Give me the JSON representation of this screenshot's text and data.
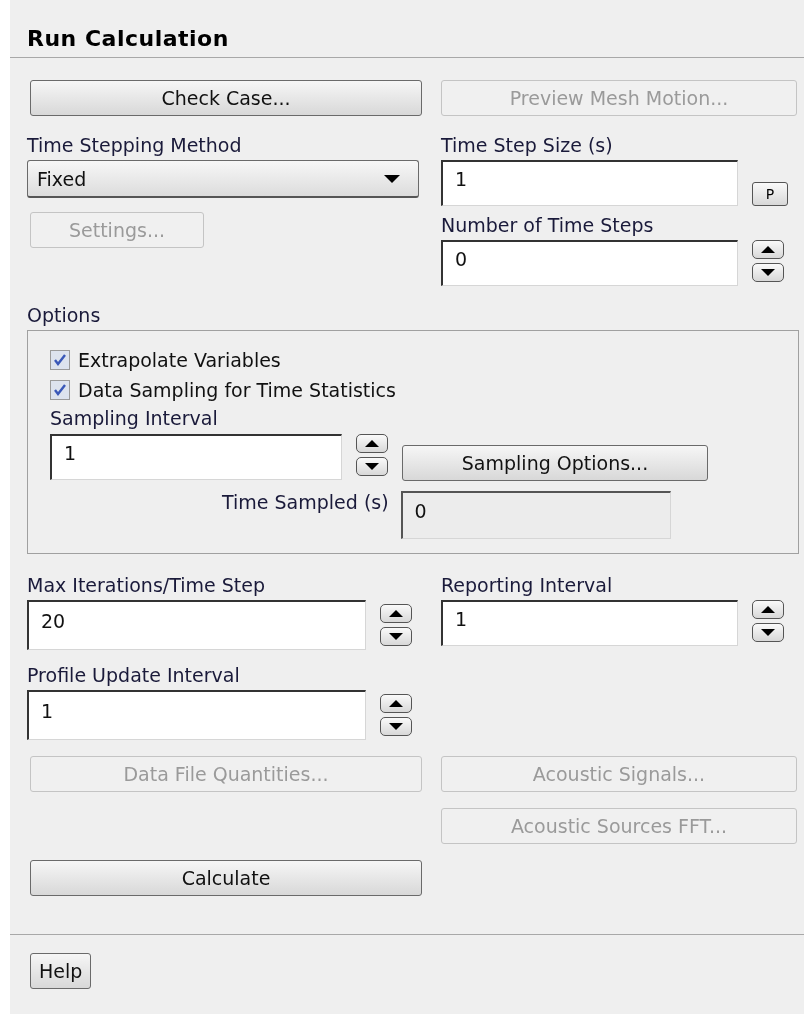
{
  "title": "Run Calculation",
  "check_case": {
    "label": "Check Case...",
    "disabled": false
  },
  "preview_mesh_motion": {
    "label": "Preview Mesh Motion...",
    "disabled": true
  },
  "time_stepping_method": {
    "label": "Time Stepping Method",
    "value": "Fixed"
  },
  "settings": {
    "label": "Settings...",
    "disabled": true
  },
  "time_step_size": {
    "label": "Time Step Size (s)",
    "value": "1",
    "parameter_button": "P"
  },
  "number_of_time_steps": {
    "label": "Number of Time Steps",
    "value": "0"
  },
  "options": {
    "label": "Options",
    "checkboxes": [
      {
        "label": "Extrapolate Variables",
        "checked": true
      },
      {
        "label": "Data Sampling for Time Statistics",
        "checked": true
      }
    ],
    "sampling_interval": {
      "label": "Sampling Interval",
      "value": "1"
    },
    "sampling_options": {
      "label": "Sampling Options...",
      "disabled": false
    },
    "time_sampled": {
      "label": "Time Sampled (s)",
      "value": "0",
      "disabled": true
    }
  },
  "max_iterations_per_time_step": {
    "label": "Max Iterations/Time Step",
    "value": "20"
  },
  "reporting_interval": {
    "label": "Reporting Interval",
    "value": "1"
  },
  "profile_update_interval": {
    "label": "Profile Update Interval",
    "value": "1"
  },
  "data_file_quantities": {
    "label": "Data File Quantities...",
    "disabled": true
  },
  "acoustic_signals": {
    "label": "Acoustic Signals...",
    "disabled": true
  },
  "acoustic_sources_fft": {
    "label": "Acoustic Sources FFT...",
    "disabled": true
  },
  "calculate": {
    "label": "Calculate",
    "disabled": false
  },
  "help": {
    "label": "Help",
    "disabled": false
  }
}
